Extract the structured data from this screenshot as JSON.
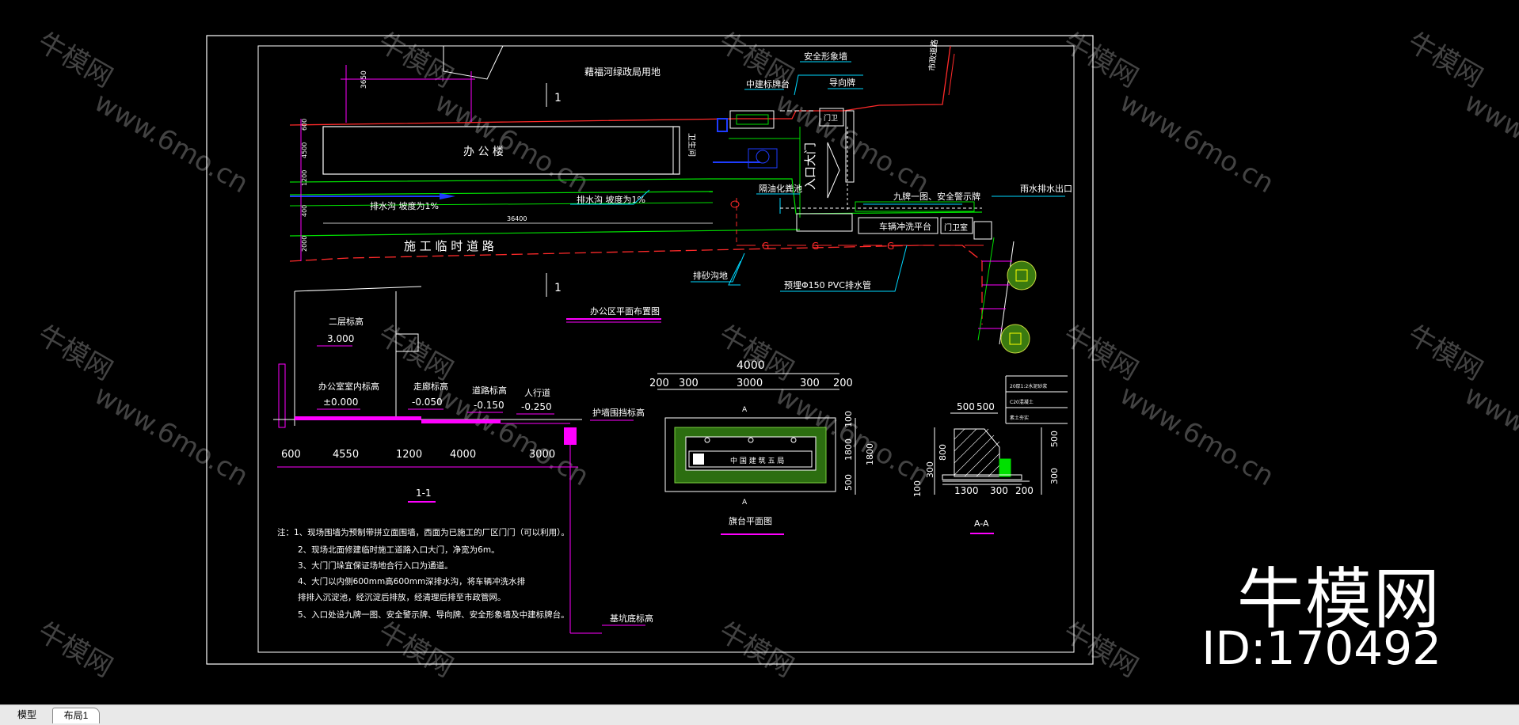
{
  "watermark": {
    "tile_brand": "牛模网",
    "tile_url": "www.6mo.cn",
    "brand": "牛模网",
    "id": "ID:170492"
  },
  "drawing": {
    "plan_top_label": "藉福河绿政局用地",
    "office_building": "办  公  楼",
    "toilet": "卫生间",
    "drain_left": "排水沟  坡度为1%",
    "drain_mid": "排水沟  坡度为1%",
    "dim_building_length": "36400",
    "temp_road": "施  工  临  时  道  路",
    "section_mark_top": "1",
    "section_mark_bottom": "1",
    "safety_board": "安全形象墙",
    "info_board": "中建标牌台",
    "guide_sign": "导向牌",
    "guard_box": "门卫",
    "entrance": "入口大门",
    "septic": "隔油化粪池",
    "nine_boards": "九牌一图、安全警示牌",
    "washing_pool": "车辆冲洗平台",
    "guard_room": "门卫室",
    "rain_outlet": "雨水排水出口",
    "sedimentation": "排砂沟地",
    "pvc_pipe": "预埋Φ150  PVC排水管",
    "plan_title": "办公区平面布置图",
    "road_label_right": "市政道路",
    "dim_left_vertical": [
      "600",
      "4500",
      "1200",
      "400",
      "2000"
    ],
    "dim_left_top": "3650",
    "section": {
      "second_floor_label": "二层标高",
      "second_floor_value": "3.000",
      "office_floor_label": "办公室室内标高",
      "office_floor_value": "±0.000",
      "corridor_label": "走廊标高",
      "corridor_value": "-0.050",
      "road_label": "道路标高",
      "road_value": "-0.150",
      "sidewalk_label": "人行道",
      "sidewalk_value": "-0.250",
      "fence_label": "护墙围挡标高",
      "bottom_label": "基坑底标高",
      "dims": [
        "600",
        "4550",
        "1200",
        "4000",
        "3000"
      ],
      "title": "1-1"
    },
    "pool_plan": {
      "dim_total": "4000",
      "dims_top": [
        "200",
        "300",
        "3000",
        "300",
        "200"
      ],
      "dims_right": [
        "100",
        "1800",
        "1800",
        "500"
      ],
      "inner_text": "中 国 建 筑 五 局",
      "section_a_top": "A",
      "section_a_bottom": "A",
      "title": "旗台平面图"
    },
    "aa_section": {
      "dims_top": [
        "500",
        "500"
      ],
      "dims_left": [
        "800",
        "300",
        "100"
      ],
      "dims_right": [
        "500",
        "300"
      ],
      "dims_bottom": [
        "1300",
        "300",
        "200"
      ],
      "layer1": "20厚1:2水泥砂浆",
      "layer2": "C20混凝土",
      "layer3": "素土夯实",
      "title": "A-A"
    },
    "notes": [
      "注：1、现场围墙为预制带拼立面围墙，西面为已施工的厂区门门（可以利用）。",
      "2、现场北面修建临时施工道路入口大门，净宽为6m。",
      "3、大门门垛宜保证场地合行入口为通道。",
      "4、大门以内侧600mm高600mm深排水沟，将车辆冲洗水排",
      "排排入沉淀池，经沉淀后排放，经清理后排至市政管网。",
      "5、入口处设九牌一图、安全警示牌、导向牌、安全形象墙及中建标牌台。"
    ]
  },
  "tabs": {
    "model": "模型",
    "layout1": "布局1"
  },
  "colors": {
    "red": "#ff2a2a",
    "green": "#00e000",
    "magenta": "#ff00ff",
    "cyan": "#00d8ff",
    "blue": "#1e3cff",
    "white": "#ffffff",
    "yellow": "#ffff00"
  }
}
